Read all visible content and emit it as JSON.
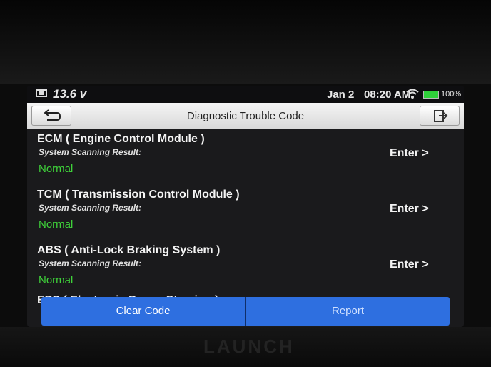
{
  "device": {
    "brand": "LAUNCH"
  },
  "status_bar": {
    "voltage": "13.6 v",
    "date": "Jan 2",
    "time": "08:20 AM",
    "battery": "100%",
    "icons": [
      "battery-voltage-icon",
      "wifi-icon",
      "battery-icon"
    ],
    "battery_color": "#2fd13a"
  },
  "header": {
    "title": "Diagnostic Trouble Code",
    "back_icon": "back-arrow-icon",
    "exit_icon": "exit-icon"
  },
  "systems": [
    {
      "name": "ECM ( Engine Control Module )",
      "result_label": "System Scanning Result:",
      "result": "Normal",
      "action": "Enter >"
    },
    {
      "name": "TCM ( Transmission Control Module )",
      "result_label": "System Scanning Result:",
      "result": "Normal",
      "action": "Enter >"
    },
    {
      "name": "ABS ( Anti-Lock Braking System )",
      "result_label": "System Scanning Result:",
      "result": "Normal",
      "action": "Enter >"
    },
    {
      "name": "EPS ( Electronic Power Steering )"
    }
  ],
  "buttons": {
    "clear": "Clear Code",
    "report": "Report"
  },
  "colors": {
    "normal_status": "#3fd23a",
    "button_bar": "#2e6fe0"
  }
}
